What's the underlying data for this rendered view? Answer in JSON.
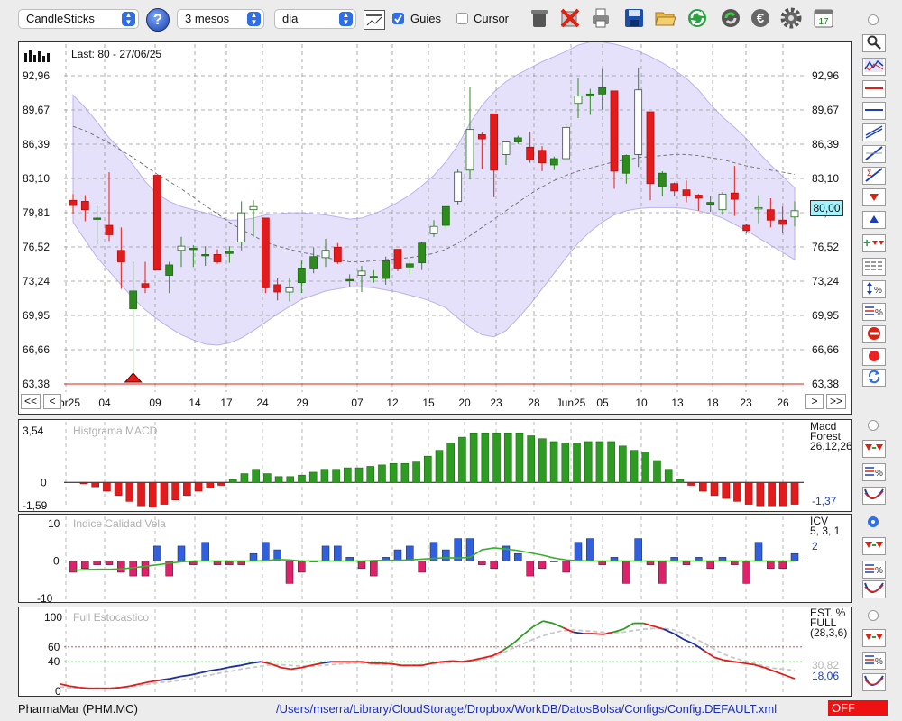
{
  "toolbar": {
    "chart_type": "CandleSticks",
    "help_label": "?",
    "period": "3 mesos",
    "interval": "dia",
    "guides_label": "Guies",
    "guides_checked": true,
    "cursor_label": "Cursor",
    "cursor_checked": false,
    "calendar_day": "17"
  },
  "main": {
    "last_label": "Last: 80 - 27/06/25",
    "price_ticks": [
      "92,96",
      "89,67",
      "86,39",
      "83,10",
      "79,81",
      "76,52",
      "73,24",
      "69,95",
      "66,66",
      "63,38"
    ],
    "last_price_badge": "80,00",
    "date_ticks": [
      "Abr25",
      "04",
      "09",
      "14",
      "17",
      "24",
      "29",
      "07",
      "12",
      "15",
      "20",
      "23",
      "28",
      "Jun25",
      "05",
      "10",
      "13",
      "18",
      "23",
      "26"
    ],
    "nav": {
      "first": "<<",
      "prev": "<",
      "next": ">",
      "last": ">>"
    }
  },
  "macd": {
    "title": "Histgrama MACD",
    "ticks": [
      "3,54",
      "0",
      "-1,59"
    ],
    "right_label_1": "Macd",
    "right_label_2": "Forest",
    "right_label_3": "26,12,26",
    "value": "-1,37"
  },
  "icv": {
    "title": "Indice Calidad Vela",
    "ticks": [
      "10",
      "0",
      "-10"
    ],
    "right_label_1": "ICV",
    "right_label_2": "5, 3, 1",
    "value": "2"
  },
  "stoch": {
    "title": "Full Estocastico",
    "ticks": [
      "100",
      "60",
      "40",
      "0"
    ],
    "right_label_1": "EST. %",
    "right_label_2": "FULL",
    "right_label_3": "(28,3,6)",
    "value_1": "30,82",
    "value_2": "18,06"
  },
  "status": {
    "symbol": "PharmaMar (PHM.MC)",
    "path": "/Users/mserra/Library/CloudStorage/Dropbox/WorkDB/DatosBolsa/Configs/Config.DEFAULT.xml",
    "off_label": "OFF"
  },
  "colors": {
    "up": "#2e8b1e",
    "down": "#e21c1c",
    "band": "#e4defa",
    "accent": "#2f6ee5"
  },
  "chart_data": [
    {
      "type": "candlestick",
      "title": "",
      "ylim": [
        63.38,
        96.25
      ],
      "candles": [
        {
          "date": "01/04",
          "o": 81.0,
          "h": 81.6,
          "l": 79.7,
          "c": 80.5
        },
        {
          "date": "02/04",
          "o": 80.9,
          "h": 81.5,
          "l": 79.0,
          "c": 80.1
        },
        {
          "date": "03/04",
          "o": 79.3,
          "h": 80.6,
          "l": 76.8,
          "c": 79.3
        },
        {
          "date": "04/04",
          "o": 78.6,
          "h": 83.7,
          "l": 77.1,
          "c": 77.7
        },
        {
          "date": "07/04",
          "o": 76.2,
          "h": 78.4,
          "l": 72.5,
          "c": 75.1
        },
        {
          "date": "08/04",
          "o": 70.6,
          "h": 75.1,
          "l": 63.6,
          "c": 72.3
        },
        {
          "date": "09/04",
          "o": 73.0,
          "h": 75.1,
          "l": 72.1,
          "c": 72.6
        },
        {
          "date": "10/04",
          "o": 83.4,
          "h": 83.4,
          "l": 74.3,
          "c": 74.3
        },
        {
          "date": "11/04",
          "o": 73.8,
          "h": 75.1,
          "l": 72.1,
          "c": 74.8
        },
        {
          "date": "14/04",
          "o": 76.2,
          "h": 77.5,
          "l": 74.6,
          "c": 76.6
        },
        {
          "date": "15/04",
          "o": 76.4,
          "h": 76.7,
          "l": 74.6,
          "c": 76.4
        },
        {
          "date": "16/04",
          "o": 75.8,
          "h": 76.6,
          "l": 74.7,
          "c": 75.8
        },
        {
          "date": "17/04",
          "o": 75.8,
          "h": 76.3,
          "l": 74.9,
          "c": 75.1
        },
        {
          "date": "22/04",
          "o": 75.9,
          "h": 76.6,
          "l": 75.0,
          "c": 76.1
        },
        {
          "date": "23/04",
          "o": 77.0,
          "h": 80.9,
          "l": 76.2,
          "c": 79.8
        },
        {
          "date": "24/04",
          "o": 80.1,
          "h": 81.0,
          "l": 77.5,
          "c": 80.4
        },
        {
          "date": "25/04",
          "o": 79.3,
          "h": 79.3,
          "l": 72.1,
          "c": 72.6
        },
        {
          "date": "28/04",
          "o": 72.9,
          "h": 73.5,
          "l": 71.4,
          "c": 72.2
        },
        {
          "date": "29/04",
          "o": 72.2,
          "h": 73.6,
          "l": 71.3,
          "c": 72.6
        },
        {
          "date": "30/04",
          "o": 73.1,
          "h": 75.2,
          "l": 72.1,
          "c": 74.5
        },
        {
          "date": "02/05",
          "o": 74.5,
          "h": 76.5,
          "l": 74.0,
          "c": 75.6
        },
        {
          "date": "05/05",
          "o": 75.5,
          "h": 77.3,
          "l": 74.6,
          "c": 76.2
        },
        {
          "date": "06/05",
          "o": 76.5,
          "h": 76.9,
          "l": 74.9,
          "c": 75.1
        },
        {
          "date": "07/05",
          "o": 73.4,
          "h": 73.9,
          "l": 72.7,
          "c": 73.4
        },
        {
          "date": "08/05",
          "o": 73.8,
          "h": 74.7,
          "l": 72.2,
          "c": 74.2
        },
        {
          "date": "09/05",
          "o": 73.7,
          "h": 74.3,
          "l": 73.1,
          "c": 73.7
        },
        {
          "date": "12/05",
          "o": 73.5,
          "h": 75.6,
          "l": 72.9,
          "c": 75.2
        },
        {
          "date": "13/05",
          "o": 76.3,
          "h": 76.3,
          "l": 74.2,
          "c": 74.5
        },
        {
          "date": "14/05",
          "o": 74.6,
          "h": 75.2,
          "l": 73.9,
          "c": 74.9
        },
        {
          "date": "15/05",
          "o": 75.0,
          "h": 77.0,
          "l": 74.3,
          "c": 76.9
        },
        {
          "date": "16/05",
          "o": 77.8,
          "h": 79.1,
          "l": 77.5,
          "c": 78.5
        },
        {
          "date": "19/05",
          "o": 78.6,
          "h": 80.6,
          "l": 78.3,
          "c": 80.4
        },
        {
          "date": "20/05",
          "o": 80.9,
          "h": 84.0,
          "l": 80.6,
          "c": 83.7
        },
        {
          "date": "21/05",
          "o": 83.9,
          "h": 91.9,
          "l": 83.0,
          "c": 87.8
        },
        {
          "date": "22/05",
          "o": 87.3,
          "h": 87.5,
          "l": 84.0,
          "c": 86.9
        },
        {
          "date": "23/05",
          "o": 89.3,
          "h": 89.3,
          "l": 81.3,
          "c": 83.9
        },
        {
          "date": "26/05",
          "o": 85.4,
          "h": 86.7,
          "l": 84.4,
          "c": 86.6
        },
        {
          "date": "27/05",
          "o": 86.6,
          "h": 87.2,
          "l": 86.4,
          "c": 87.0
        },
        {
          "date": "28/05",
          "o": 86.1,
          "h": 87.6,
          "l": 84.6,
          "c": 84.9
        },
        {
          "date": "29/05",
          "o": 85.8,
          "h": 86.2,
          "l": 83.8,
          "c": 84.6
        },
        {
          "date": "30/05",
          "o": 84.4,
          "h": 85.2,
          "l": 83.9,
          "c": 85.0
        },
        {
          "date": "02/06",
          "o": 85.0,
          "h": 88.3,
          "l": 85.0,
          "c": 88.0
        },
        {
          "date": "03/06",
          "o": 90.3,
          "h": 92.7,
          "l": 88.9,
          "c": 91.0
        },
        {
          "date": "04/06",
          "o": 91.0,
          "h": 91.7,
          "l": 89.2,
          "c": 91.2
        },
        {
          "date": "05/06",
          "o": 91.2,
          "h": 93.6,
          "l": 89.7,
          "c": 91.8
        },
        {
          "date": "06/06",
          "o": 91.5,
          "h": 91.5,
          "l": 82.1,
          "c": 83.8
        },
        {
          "date": "09/06",
          "o": 83.6,
          "h": 85.4,
          "l": 82.6,
          "c": 85.3
        },
        {
          "date": "10/06",
          "o": 85.4,
          "h": 93.7,
          "l": 84.2,
          "c": 91.6
        },
        {
          "date": "11/06",
          "o": 89.5,
          "h": 89.5,
          "l": 81.0,
          "c": 82.6
        },
        {
          "date": "12/06",
          "o": 82.3,
          "h": 83.8,
          "l": 81.4,
          "c": 83.6
        },
        {
          "date": "13/06",
          "o": 82.6,
          "h": 82.7,
          "l": 81.4,
          "c": 81.9
        },
        {
          "date": "16/06",
          "o": 82.0,
          "h": 82.9,
          "l": 80.8,
          "c": 81.4
        },
        {
          "date": "17/06",
          "o": 81.5,
          "h": 81.6,
          "l": 80.0,
          "c": 81.2
        },
        {
          "date": "18/06",
          "o": 80.6,
          "h": 81.4,
          "l": 79.9,
          "c": 80.8
        },
        {
          "date": "19/06",
          "o": 80.1,
          "h": 81.8,
          "l": 79.6,
          "c": 81.6
        },
        {
          "date": "20/06",
          "o": 81.7,
          "h": 84.3,
          "l": 79.5,
          "c": 81.1
        },
        {
          "date": "23/06",
          "o": 78.6,
          "h": 78.7,
          "l": 77.8,
          "c": 78.1
        },
        {
          "date": "24/06",
          "o": 80.3,
          "h": 81.5,
          "l": 78.8,
          "c": 80.3
        },
        {
          "date": "25/06",
          "o": 80.1,
          "h": 81.2,
          "l": 78.4,
          "c": 79.1
        },
        {
          "date": "26/06",
          "o": 79.1,
          "h": 80.4,
          "l": 77.9,
          "c": 78.7
        },
        {
          "date": "27/06",
          "o": 79.4,
          "h": 80.9,
          "l": 78.5,
          "c": 80.0
        }
      ],
      "bands": {
        "upper": [
          91.1,
          89.9,
          88.5,
          87.0,
          85.8,
          84.4,
          82.8,
          81.6,
          80.9,
          80.4,
          80.1,
          79.8,
          79.4,
          79.1,
          79.1,
          79.3,
          79.6,
          79.7,
          79.8,
          79.8,
          79.7,
          79.6,
          79.4,
          79.2,
          79.3,
          79.7,
          80.2,
          80.8,
          81.5,
          82.4,
          83.4,
          84.7,
          86.3,
          88.4,
          90.1,
          91.4,
          92.4,
          93.1,
          93.7,
          94.3,
          94.8,
          95.3,
          95.9,
          96.2,
          96.2,
          96.0,
          95.7,
          95.3,
          94.8,
          94.2,
          93.5,
          92.7,
          91.6,
          90.2,
          89.0,
          88.0,
          86.9,
          85.6,
          84.4,
          83.3,
          82.2
        ],
        "mid": [
          88.1,
          87.7,
          87.1,
          86.5,
          85.8,
          85.1,
          84.3,
          83.5,
          82.8,
          82.1,
          81.3,
          80.5,
          79.7,
          78.9,
          78.2,
          77.6,
          77.0,
          76.6,
          76.3,
          76.0,
          75.8,
          75.5,
          75.3,
          75.1,
          75.1,
          75.2,
          75.3,
          75.4,
          75.5,
          75.7,
          75.9,
          76.3,
          76.9,
          77.6,
          78.4,
          79.2,
          80.0,
          80.8,
          81.6,
          82.3,
          82.9,
          83.4,
          83.8,
          84.1,
          84.4,
          84.7,
          84.9,
          85.1,
          85.2,
          85.3,
          85.4,
          85.4,
          85.3,
          85.1,
          84.9,
          84.6,
          84.3,
          84.1,
          83.9,
          83.7,
          83.5
        ],
        "lower": [
          78.9,
          77.2,
          75.5,
          74.2,
          72.9,
          71.6,
          70.5,
          69.6,
          68.8,
          68.1,
          67.6,
          67.2,
          67.1,
          67.3,
          67.8,
          68.5,
          69.3,
          70.1,
          70.8,
          71.5,
          71.9,
          72.3,
          72.5,
          72.7,
          72.7,
          72.6,
          72.4,
          72.2,
          71.9,
          71.6,
          71.2,
          70.7,
          69.7,
          68.8,
          68.1,
          67.9,
          68.5,
          69.7,
          71.0,
          72.5,
          74.0,
          75.5,
          76.9,
          78.0,
          78.9,
          79.6,
          80.0,
          80.2,
          80.3,
          80.3,
          80.3,
          80.2,
          80.0,
          79.7,
          79.3,
          78.7,
          78.1,
          77.4,
          76.7,
          76.0,
          75.3
        ]
      },
      "horizontal_line": 63.38
    },
    {
      "type": "bar",
      "title": "Histgrama MACD",
      "ylim": [
        -1.59,
        3.54
      ],
      "values": [
        -0.1,
        -0.3,
        -0.6,
        -0.9,
        -1.3,
        -1.6,
        -1.7,
        -1.5,
        -1.2,
        -0.9,
        -0.6,
        -0.4,
        -0.2,
        0.2,
        0.6,
        0.9,
        0.6,
        0.4,
        0.4,
        0.5,
        0.7,
        0.9,
        0.9,
        1.0,
        1.0,
        1.1,
        1.2,
        1.3,
        1.3,
        1.4,
        1.8,
        2.2,
        2.7,
        3.1,
        3.4,
        3.4,
        3.4,
        3.4,
        3.4,
        3.2,
        3.0,
        2.8,
        2.7,
        2.7,
        2.8,
        2.8,
        2.8,
        2.5,
        2.2,
        2.1,
        1.5,
        0.9,
        0.2,
        -0.2,
        -0.6,
        -0.9,
        -1.1,
        -1.3,
        -1.5,
        -1.6,
        -1.6,
        -1.6,
        -1.5
      ]
    },
    {
      "type": "bar+line",
      "title": "Indice Calidad Vela",
      "ylim": [
        -10,
        10
      ],
      "values": [
        -3,
        -2,
        -1,
        -1,
        -3,
        -4,
        -4,
        4,
        -4,
        4,
        -1,
        5,
        -1,
        -1,
        -1,
        2,
        5,
        3,
        -6,
        -3,
        0,
        4,
        4,
        1,
        -2,
        -4,
        1,
        3,
        4,
        -3,
        5,
        3,
        6,
        6,
        -1,
        -2,
        4,
        2,
        -4,
        -2,
        0,
        -3,
        5,
        6,
        -1,
        1,
        -6,
        6,
        -1,
        -6,
        1,
        -1,
        1,
        -2,
        1,
        -1,
        -6,
        5,
        -2,
        -2,
        2
      ],
      "line": [
        -2.5,
        -2.3,
        -2.2,
        -2.2,
        -2.1,
        -1.8,
        -1.4,
        -1.0,
        -0.6,
        -0.2,
        0.0,
        0.0,
        0.0,
        0.0,
        0.0,
        0.0,
        0.1,
        0.4,
        0.3,
        0.0,
        0.0,
        0.0,
        0.0,
        0.0,
        0.0,
        0.1,
        0.2,
        0.2,
        0.3,
        0.5,
        0.7,
        0.9,
        0.8,
        1.0,
        3.0,
        3.5,
        3.2,
        2.8,
        2.2,
        1.6,
        0.8,
        0.3,
        0.1,
        0.0,
        0.0,
        0.0,
        0.0,
        0.0,
        0.0,
        0.0,
        0.0,
        0.0,
        0.0,
        0.0,
        0.0,
        0.0,
        0.0,
        0.0,
        0.0,
        0.0,
        0.0
      ]
    },
    {
      "type": "line",
      "title": "Full Estocastico",
      "ylim": [
        0,
        100
      ],
      "lines_ref": [
        60,
        40
      ],
      "series": [
        {
          "values": [
            10,
            7,
            5,
            4,
            4,
            4,
            5,
            7,
            10,
            13,
            15,
            17,
            20,
            22,
            25,
            28,
            30,
            33,
            35,
            38,
            40,
            37,
            32,
            30,
            32,
            35,
            38,
            40,
            40,
            40,
            40,
            38,
            38,
            37,
            35,
            35,
            35,
            38,
            40,
            41,
            40,
            42,
            45,
            48,
            55,
            64,
            76,
            87,
            95,
            92,
            86,
            80,
            78,
            78,
            77,
            80,
            84,
            92,
            92,
            88,
            84,
            78,
            70,
            64,
            55,
            46,
            42,
            40,
            38,
            36,
            32,
            27,
            22,
            17
          ]
        },
        {
          "values": [
            6,
            5,
            4,
            4,
            4,
            4,
            5,
            6,
            8,
            10,
            12,
            13,
            15,
            17,
            20,
            22,
            25,
            27,
            30,
            32,
            34,
            36,
            36,
            35,
            34,
            34,
            35,
            36,
            37,
            38,
            38,
            37,
            36,
            36,
            35,
            35,
            36,
            37,
            38,
            39,
            40,
            41,
            43,
            46,
            52,
            58,
            64,
            70,
            75,
            79,
            82,
            83,
            82,
            81,
            80,
            79,
            80,
            82,
            84,
            85,
            85,
            83,
            78,
            72,
            65,
            57,
            50,
            45,
            41,
            38,
            34,
            31,
            30,
            28
          ]
        }
      ]
    }
  ]
}
